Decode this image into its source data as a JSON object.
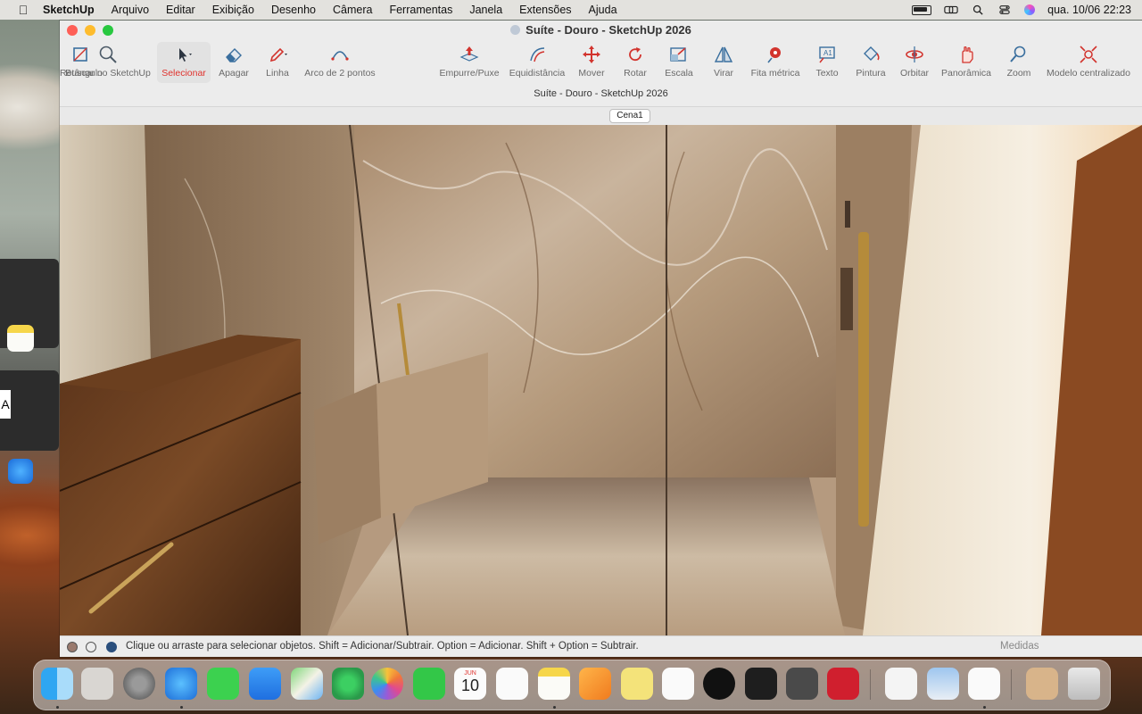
{
  "menubar": {
    "apple_icon": "apple-icon",
    "app_name": "SketchUp",
    "items": [
      "Arquivo",
      "Editar",
      "Exibição",
      "Desenho",
      "Câmera",
      "Ferramentas",
      "Janela",
      "Extensões",
      "Ajuda"
    ],
    "clock": "qua. 10/06  22:23"
  },
  "window": {
    "title": "Suíte - Douro - SketchUp 2026",
    "subtitle": "Suíte - Douro - SketchUp 2026",
    "scene_tab": "Cena1"
  },
  "toolbar": {
    "tools": [
      {
        "label": "Buscar no SketchUp",
        "icon": "search-icon"
      },
      {
        "label": "Selecionar",
        "icon": "select-arrow-icon"
      },
      {
        "label": "Apagar",
        "icon": "eraser-icon"
      },
      {
        "label": "Linha",
        "icon": "pencil-icon"
      },
      {
        "label": "Arco de 2 pontos",
        "icon": "arc-icon"
      },
      {
        "label": "Retângulo",
        "icon": "rectangle-icon"
      },
      {
        "label": "Empurre/Puxe",
        "icon": "push-pull-icon"
      },
      {
        "label": "Equidistância",
        "icon": "offset-icon"
      },
      {
        "label": "Mover",
        "icon": "move-icon"
      },
      {
        "label": "Rotar",
        "icon": "rotate-icon"
      },
      {
        "label": "Escala",
        "icon": "scale-icon"
      },
      {
        "label": "Virar",
        "icon": "flip-icon"
      },
      {
        "label": "Fita métrica",
        "icon": "tape-measure-icon"
      },
      {
        "label": "Texto",
        "icon": "text-icon"
      },
      {
        "label": "Pintura",
        "icon": "paint-bucket-icon"
      },
      {
        "label": "Orbitar",
        "icon": "orbit-icon"
      },
      {
        "label": "Panorâmica",
        "icon": "pan-icon"
      },
      {
        "label": "Zoom",
        "icon": "zoom-icon"
      },
      {
        "label": "Modelo centralizado",
        "icon": "zoom-extents-icon"
      }
    ],
    "active_tool": "Selecionar",
    "accent_color": "#e0322d"
  },
  "statusbar": {
    "message": "Clique ou arraste para selecionar objetos. Shift = Adicionar/Subtrair. Option = Adicionar. Shift + Option = Subtrair.",
    "measurements_label": "Medidas"
  },
  "calendar_icon": {
    "month": "JUN",
    "day": "10"
  },
  "dock": {
    "apps": [
      "Finder",
      "Launchpad",
      "System Settings",
      "Safari",
      "Messages",
      "Mail",
      "Maps",
      "Find My",
      "Photos",
      "FaceTime",
      "Calendar",
      "Reminders",
      "Notes",
      "Pages",
      "Stickies",
      "Freeform",
      "Spotify",
      "Voice Memos",
      "Calculator",
      "AutoCAD",
      "Keychain",
      "Preview",
      "SketchUp",
      "Folder",
      "Trash"
    ]
  },
  "side_strip": {
    "letter": "A"
  }
}
